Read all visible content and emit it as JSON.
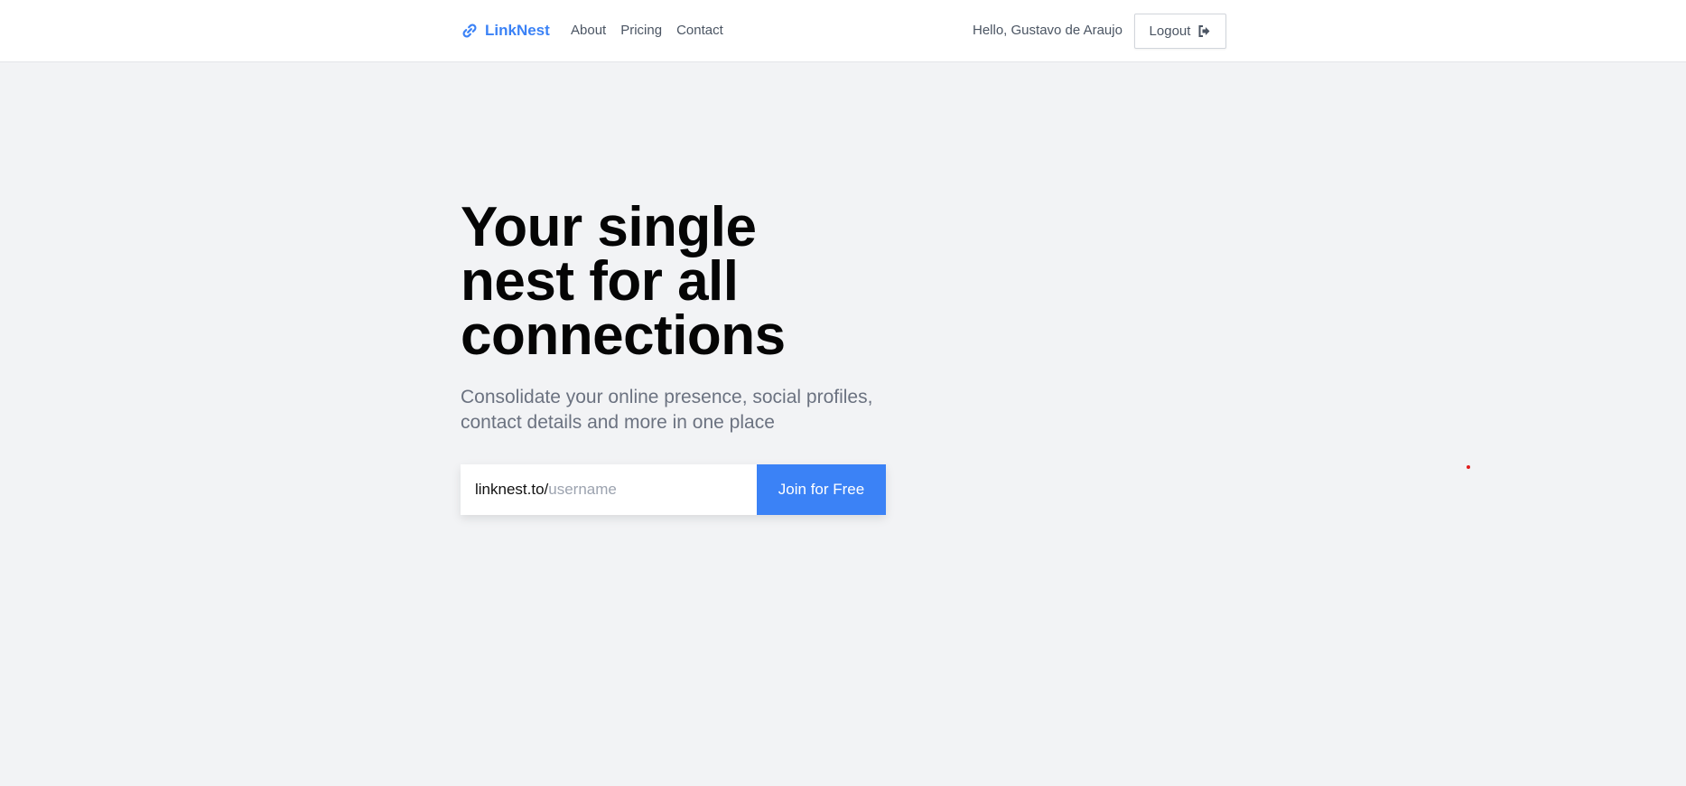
{
  "header": {
    "brand_name": "LinkNest",
    "brand_icon": "link-icon",
    "nav": [
      {
        "label": "About"
      },
      {
        "label": "Pricing"
      },
      {
        "label": "Contact"
      }
    ],
    "greeting": "Hello, Gustavo de Araujo",
    "logout_label": "Logout",
    "logout_icon": "sign-out-icon"
  },
  "hero": {
    "title": "Your single nest for all connections",
    "subtitle": "Consolidate your online presence, social profiles, contact details and more in one place"
  },
  "signup": {
    "prefix": "linknest.to/",
    "username_placeholder": "username",
    "username_value": "",
    "button_label": "Join for Free"
  },
  "colors": {
    "accent": "#3b82f6",
    "background": "#f2f3f5",
    "cursor_dot": "#e11d1d"
  }
}
